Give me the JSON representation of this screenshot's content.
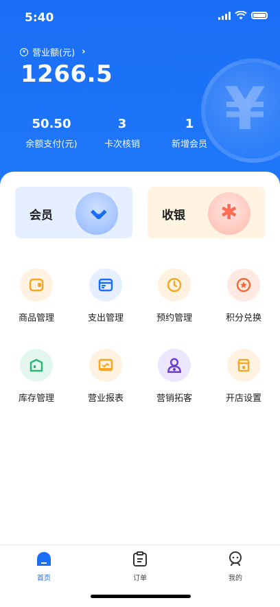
{
  "status_bar": {
    "time": "5:40"
  },
  "revenue": {
    "label": "营业额(元)",
    "value": "1266.5"
  },
  "stats": [
    {
      "value": "50.50",
      "label": "余额支付(元)"
    },
    {
      "value": "3",
      "label": "卡次核销"
    },
    {
      "value": "1",
      "label": "新增会员"
    }
  ],
  "cards": {
    "member": "会员",
    "cashier": "收银"
  },
  "functions": [
    {
      "label": "商品管理",
      "icon": "wallet-icon"
    },
    {
      "label": "支出管理",
      "icon": "card-icon"
    },
    {
      "label": "预约管理",
      "icon": "clock-icon"
    },
    {
      "label": "积分兑换",
      "icon": "star-badge-icon"
    },
    {
      "label": "库存管理",
      "icon": "warehouse-icon"
    },
    {
      "label": "营业报表",
      "icon": "report-icon"
    },
    {
      "label": "营销拓客",
      "icon": "user-add-icon"
    },
    {
      "label": "开店设置",
      "icon": "store-icon"
    }
  ],
  "tabs": [
    {
      "label": "首页",
      "icon": "home-icon",
      "active": true
    },
    {
      "label": "订单",
      "icon": "order-icon",
      "active": false
    },
    {
      "label": "我的",
      "icon": "profile-icon",
      "active": false
    }
  ],
  "colors": {
    "primary": "#1a6ef5",
    "member_bg": "#e5efff",
    "cashier_bg": "#fff3e2"
  }
}
